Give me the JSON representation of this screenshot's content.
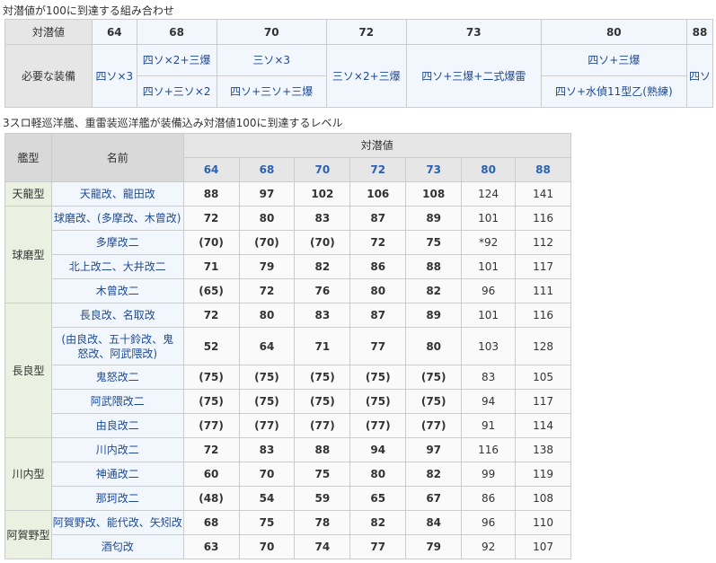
{
  "caption1": "対潜値が100に到達する組み合わせ",
  "table1": {
    "header_label": "対潜値",
    "req_label": "必要な装備",
    "values": [
      "64",
      "68",
      "70",
      "72",
      "73",
      "80",
      "88"
    ],
    "c64": "四ソ×3",
    "c68a": "四ソ×2+三爆",
    "c68b": "四ソ+三ソ×2",
    "c70a": "三ソ×3",
    "c70b": "四ソ+三ソ+三爆",
    "c72": "三ソ×2+三爆",
    "c73": "四ソ+三爆+二式爆雷",
    "c80a": "四ソ+三爆",
    "c80b": "四ソ+水偵11型乙(熟練)",
    "c88": "四ソ"
  },
  "caption2": "3スロ軽巡洋艦、重雷装巡洋艦が装備込み対潜値100に到達するレベル",
  "table2": {
    "h_type": "艦型",
    "h_name": "名前",
    "h_asw": "対潜値",
    "cols": [
      "64",
      "68",
      "70",
      "72",
      "73",
      "80",
      "88"
    ],
    "groups": [
      {
        "type": "天龍型",
        "rows": [
          {
            "name": "天龍改、龍田改",
            "v": [
              "88",
              "97",
              "102",
              "106",
              "108",
              "124",
              "141"
            ]
          }
        ]
      },
      {
        "type": "球磨型",
        "rows": [
          {
            "name": "球磨改、(多摩改、木曾改)",
            "v": [
              "72",
              "80",
              "83",
              "87",
              "89",
              "101",
              "116"
            ]
          },
          {
            "name": "多摩改二",
            "v": [
              "(70)",
              "(70)",
              "(70)",
              "72",
              "75",
              "*92",
              "112"
            ]
          },
          {
            "name": "北上改二、大井改二",
            "v": [
              "71",
              "79",
              "82",
              "86",
              "88",
              "101",
              "117"
            ]
          },
          {
            "name": "木曾改二",
            "v": [
              "(65)",
              "72",
              "76",
              "80",
              "82",
              "96",
              "111"
            ]
          }
        ]
      },
      {
        "type": "長良型",
        "rows": [
          {
            "name": "長良改、名取改",
            "v": [
              "72",
              "80",
              "83",
              "87",
              "89",
              "101",
              "116"
            ]
          },
          {
            "name": "(由良改、五十鈴改、鬼怒改、阿武隈改)",
            "v": [
              "52",
              "64",
              "71",
              "77",
              "80",
              "103",
              "128"
            ]
          },
          {
            "name": "鬼怒改二",
            "v": [
              "(75)",
              "(75)",
              "(75)",
              "(75)",
              "(75)",
              "83",
              "105"
            ]
          },
          {
            "name": "阿武隈改二",
            "v": [
              "(75)",
              "(75)",
              "(75)",
              "(75)",
              "(75)",
              "94",
              "117"
            ]
          },
          {
            "name": "由良改二",
            "v": [
              "(77)",
              "(77)",
              "(77)",
              "(77)",
              "(77)",
              "91",
              "114"
            ]
          }
        ]
      },
      {
        "type": "川内型",
        "rows": [
          {
            "name": "川内改二",
            "v": [
              "72",
              "83",
              "88",
              "94",
              "97",
              "116",
              "138"
            ]
          },
          {
            "name": "神通改二",
            "v": [
              "60",
              "70",
              "75",
              "80",
              "82",
              "99",
              "119"
            ]
          },
          {
            "name": "那珂改二",
            "v": [
              "(48)",
              "54",
              "59",
              "65",
              "67",
              "86",
              "108"
            ]
          }
        ]
      },
      {
        "type": "阿賀野型",
        "rows": [
          {
            "name": "阿賀野改、能代改、矢矧改",
            "v": [
              "68",
              "75",
              "78",
              "82",
              "84",
              "96",
              "110"
            ]
          },
          {
            "name": "酒匂改",
            "v": [
              "63",
              "70",
              "74",
              "77",
              "79",
              "92",
              "107"
            ]
          }
        ]
      }
    ]
  }
}
